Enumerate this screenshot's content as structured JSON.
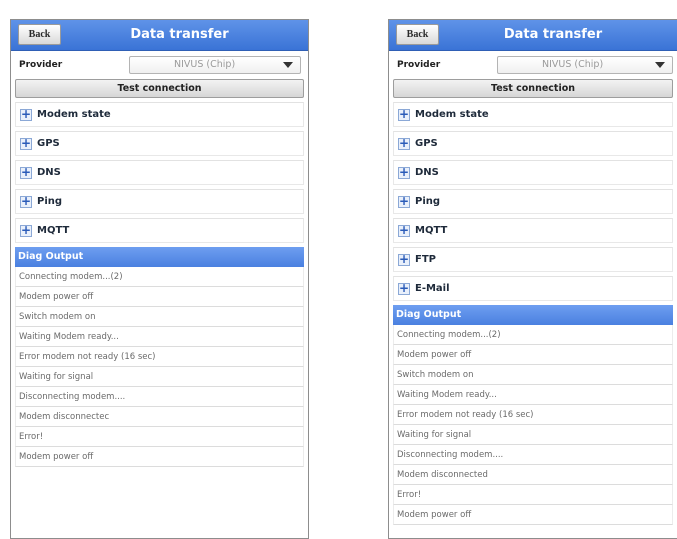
{
  "left": {
    "header": {
      "back_label": "Back",
      "title": "Data transfer"
    },
    "provider": {
      "label": "Provider",
      "value": "NIVUS (Chip)"
    },
    "test_button": "Test connection",
    "sections": [
      "Modem state",
      "GPS",
      "DNS",
      "Ping",
      "MQTT"
    ],
    "diag": {
      "header": "Diag Output",
      "lines": [
        "Connecting modem...(2)",
        "Modem power off",
        "Switch modem on",
        "Waiting Modem ready...",
        "Error modem not ready (16 sec)",
        "Waiting for signal",
        "Disconnecting modem....",
        "Modem disconnectec",
        "Error!",
        "Modem power off"
      ]
    }
  },
  "right": {
    "header": {
      "back_label": "Back",
      "title": "Data transfer"
    },
    "provider": {
      "label": "Provider",
      "value": "NIVUS (Chip)"
    },
    "test_button": "Test connection",
    "sections": [
      "Modem state",
      "GPS",
      "DNS",
      "Ping",
      "MQTT",
      "FTP",
      "E-Mail"
    ],
    "diag": {
      "header": "Diag Output",
      "lines": [
        "Connecting modem...(2)",
        "Modem power off",
        "Switch modem on",
        "Waiting Modem ready...",
        "Error modem not ready (16 sec)",
        "Waiting for signal",
        "Disconnecting modem....",
        "Modem disconnected",
        "Error!",
        "Modem power off"
      ]
    }
  },
  "icons": {
    "expand": "plus-icon",
    "dropdown": "chevron-down-icon"
  },
  "colors": {
    "header_blue": "#3a73d6",
    "diag_header_blue": "#4a80e0"
  }
}
